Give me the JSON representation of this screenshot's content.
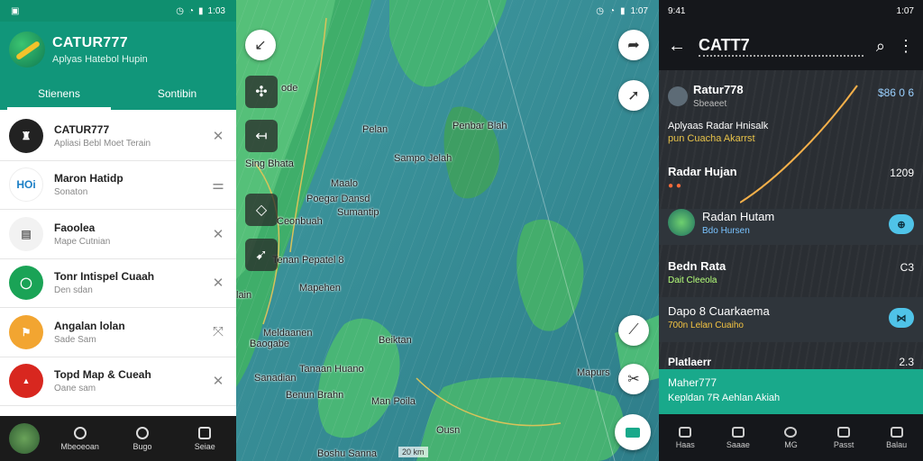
{
  "left": {
    "status_time": "1:03",
    "app_title": "CATUR777",
    "app_subtitle": "Aplyas Hatebol Hupin",
    "tabs": [
      {
        "label": "Stienens"
      },
      {
        "label": "Sontibin"
      }
    ],
    "items": [
      {
        "name": "CATUR777",
        "desc": "Apliasi Bebl Moet Terain",
        "avatar_color": "#222222",
        "avatar_icon": "chess-board-icon"
      },
      {
        "name": "Maron Hatidp",
        "desc": "Sonaton",
        "avatar_color": "#ffffff",
        "avatar_icon": "hoi-logo-icon"
      },
      {
        "name": "Faoolea",
        "desc": "Mape Cutnian",
        "avatar_color": "#f2f2f2",
        "avatar_icon": "calendar-icon"
      },
      {
        "name": "Tonr Intispel Cuaah",
        "desc": "Den sdan",
        "avatar_color": "#1aa356",
        "avatar_icon": "chat-bubble-icon"
      },
      {
        "name": "Angalan lolan",
        "desc": "Sade Sam",
        "avatar_color": "#f2a531",
        "avatar_icon": "flag-icon"
      },
      {
        "name": "Topd Map & Cueah",
        "desc": "Oane sam",
        "avatar_color": "#d8271f",
        "avatar_icon": "radar-cap-icon"
      }
    ],
    "bottom_nav": [
      {
        "label": "Mbeoeoan"
      },
      {
        "label": "Bugo"
      },
      {
        "label": "Seiae"
      }
    ]
  },
  "map": {
    "labels": [
      {
        "text": "ode"
      },
      {
        "text": "Pelan"
      },
      {
        "text": "Penbar Blah"
      },
      {
        "text": "Sampo Jelah"
      },
      {
        "text": "Sing Bhata"
      },
      {
        "text": "Maalo"
      },
      {
        "text": "Poegar Dansd"
      },
      {
        "text": "Sumantip"
      },
      {
        "text": "Ceonbuah"
      },
      {
        "text": "Tenan Pepatel 8"
      },
      {
        "text": "Mapehen"
      },
      {
        "text": "lain"
      },
      {
        "text": "Meldaanen"
      },
      {
        "text": "Baogabe"
      },
      {
        "text": "Beiktan"
      },
      {
        "text": "Tanaan Huano"
      },
      {
        "text": "Sanadian"
      },
      {
        "text": "Man Poila"
      },
      {
        "text": "Benun Brahn"
      },
      {
        "text": "Ousn"
      },
      {
        "text": "Boshu Sanna"
      },
      {
        "text": "Mapurs"
      }
    ],
    "scale_text": "20 km"
  },
  "right": {
    "status_time": "1:07",
    "status_left": "9:41",
    "app_title": "CATT7",
    "card1": {
      "title": "Ratur778",
      "sub": "Sbeaeet",
      "value": "$86 0 6"
    },
    "card1_desc": {
      "line1": "Aplyaas Radar Hnisalk",
      "line2": "pun Cuacha Akarrst"
    },
    "radar": {
      "label": "Radar Hujan",
      "value": "1209"
    },
    "radar2": {
      "title": "Radan Hutam",
      "sub": "Bdo Hursen"
    },
    "data": {
      "title": "Bedn Rata",
      "sub": "Dait Cleeola",
      "value": "C3"
    },
    "daps": {
      "title": "Dapo 8 Cuarkaema",
      "sub": "700n Lelan Cuaiho"
    },
    "plat": {
      "title": "Platlaerr",
      "value": "2.3"
    },
    "banner": {
      "title": "Maher777",
      "sub": "Kepldan 7R Aehlan Akiah"
    },
    "bottom_nav": [
      {
        "label": "Haas"
      },
      {
        "label": "Saaae"
      },
      {
        "label": "MG"
      },
      {
        "label": "Passt"
      },
      {
        "label": "Balau"
      }
    ]
  }
}
